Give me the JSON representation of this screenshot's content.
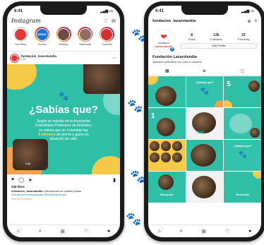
{
  "left_phone": {
    "status": {
      "time": "9:41"
    },
    "app": {
      "logo": "Instagram"
    },
    "stories": [
      {
        "label": "Your Story",
        "color": "#e53935"
      },
      {
        "label": "Ecosta",
        "color": "#1976d2"
      },
      {
        "label": "Petshop",
        "color": "#6d4c41"
      },
      {
        "label": "Veterinaria",
        "color": "#8d6e63"
      },
      {
        "label": "Cocacola",
        "color": "#d32f2f"
      }
    ],
    "stories_badge": "NEWS",
    "post": {
      "username": "fundacion_lazarolandia",
      "location": "Cali",
      "title": "¿Sabías que?",
      "body_line1": "Según un estudio de la Asociación",
      "body_line2": "Colombiana Protectora de Animales,",
      "body_line3": "se estima que en Colombia hay",
      "body_highlight": "6 millones",
      "body_line4": "de perros y gatos en",
      "body_line5": "situación de calle",
      "photo_label": "Caji",
      "likes": "238 likes",
      "caption_user": "fundacion_lazarolandia",
      "caption_text": "¡Generemos un cambio juntos",
      "hashtags": "#TenerUnPerroesAdoptar #PetsofUaCompe",
      "comments": "View all comments"
    }
  },
  "right_phone": {
    "status": {
      "time": "9:41"
    },
    "profile": {
      "username": "fundacion_lazarolandia",
      "logo_line1": "Fundación",
      "logo_line2": "Lazarolandia",
      "stats": [
        {
          "num": "8",
          "label": "Posts"
        },
        {
          "num": "13k",
          "label": "Followers"
        },
        {
          "num": "33",
          "label": "Following"
        }
      ],
      "edit_button": "Edit Profile",
      "name": "Fundación Lazarolandia",
      "bio": "Salvando peluditos con todo el corazón"
    },
    "grid": [
      {
        "type": "photo"
      },
      {
        "type": "title",
        "text": "¿Sabías que?"
      },
      {
        "type": "number",
        "text": "5"
      },
      {
        "type": "number",
        "text": "1"
      },
      {
        "type": "photo",
        "label": "Caji"
      },
      {
        "type": "title",
        "text": ""
      },
      {
        "type": "collage"
      },
      {
        "type": "photo"
      },
      {
        "type": "title",
        "text": "¿Sabías que?"
      },
      {
        "type": "title",
        "text": "Recuerda"
      },
      {
        "type": "photo"
      },
      {
        "type": "title",
        "text": "Recuerda"
      }
    ]
  }
}
